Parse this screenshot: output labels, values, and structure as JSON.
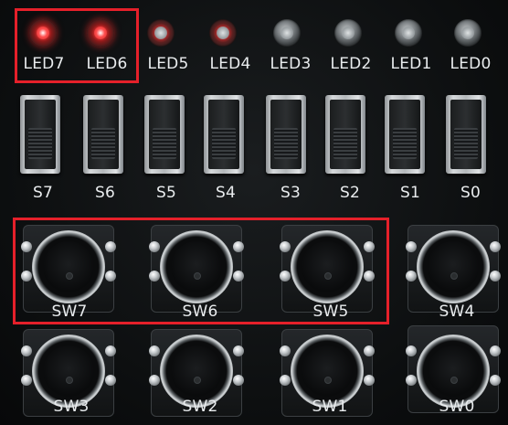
{
  "leds": [
    {
      "label": "LED7",
      "state": "on"
    },
    {
      "label": "LED6",
      "state": "on"
    },
    {
      "label": "LED5",
      "state": "on"
    },
    {
      "label": "LED4",
      "state": "on"
    },
    {
      "label": "LED3",
      "state": "off"
    },
    {
      "label": "LED2",
      "state": "off"
    },
    {
      "label": "LED1",
      "state": "off"
    },
    {
      "label": "LED0",
      "state": "off"
    }
  ],
  "slide_switches": [
    "S7",
    "S6",
    "S5",
    "S4",
    "S3",
    "S2",
    "S1",
    "S0"
  ],
  "push_buttons": [
    "SW7",
    "SW6",
    "SW5",
    "SW4",
    "SW3",
    "SW2",
    "SW1",
    "SW0"
  ],
  "colors": {
    "highlight_box": "#e5202a",
    "led_on": "#ff3030",
    "label_text": "#e9ecee"
  }
}
